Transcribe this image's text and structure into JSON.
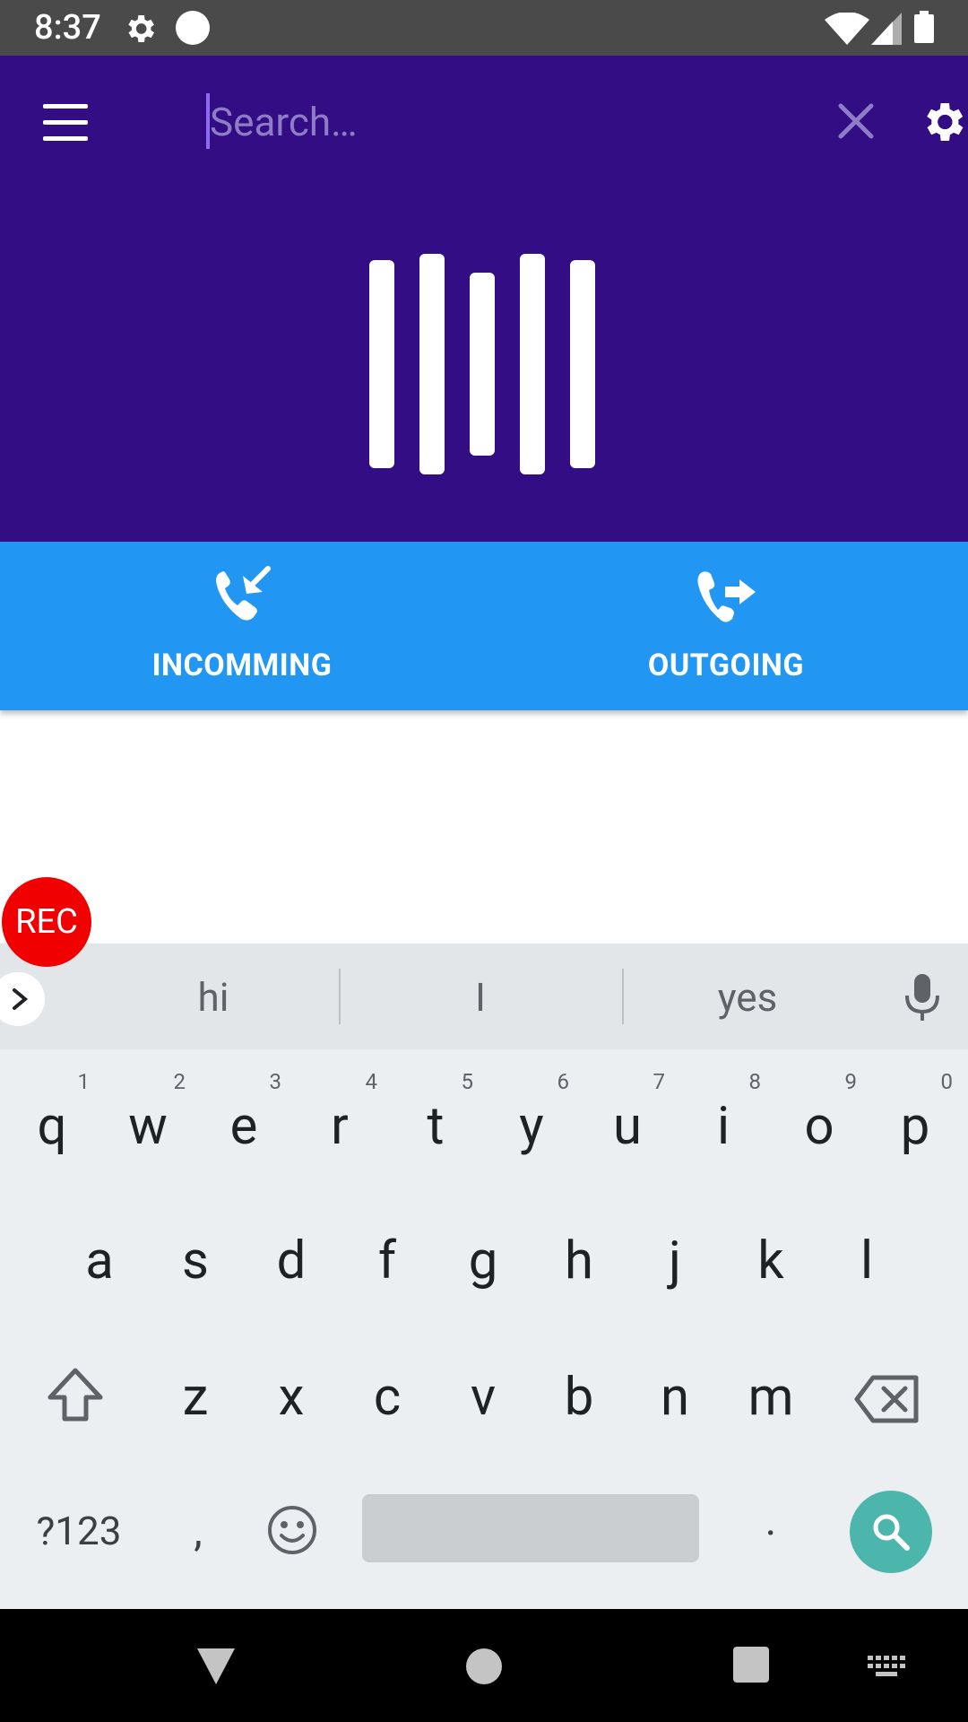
{
  "status_bar": {
    "time": "8:37",
    "icons": [
      "gear-icon",
      "dot-icon",
      "wifi-icon",
      "signal-icon",
      "battery-icon"
    ]
  },
  "header": {
    "search_placeholder": "Search…",
    "search_value": "",
    "background_color": "#320d84"
  },
  "tabs": [
    {
      "label": "INCOMMING",
      "icon": "incoming-call-icon"
    },
    {
      "label": "OUTGOING",
      "icon": "outgoing-call-icon"
    }
  ],
  "tabs_color": "#2196f3",
  "rec_button": {
    "label": "REC",
    "color": "#f00000"
  },
  "keyboard": {
    "suggestions": [
      "hi",
      "I",
      "yes"
    ],
    "row1": [
      {
        "key": "q",
        "hint": "1"
      },
      {
        "key": "w",
        "hint": "2"
      },
      {
        "key": "e",
        "hint": "3"
      },
      {
        "key": "r",
        "hint": "4"
      },
      {
        "key": "t",
        "hint": "5"
      },
      {
        "key": "y",
        "hint": "6"
      },
      {
        "key": "u",
        "hint": "7"
      },
      {
        "key": "i",
        "hint": "8"
      },
      {
        "key": "o",
        "hint": "9"
      },
      {
        "key": "p",
        "hint": "0"
      }
    ],
    "row2": [
      "a",
      "s",
      "d",
      "f",
      "g",
      "h",
      "j",
      "k",
      "l"
    ],
    "row3": [
      "z",
      "x",
      "c",
      "v",
      "b",
      "n",
      "m"
    ],
    "symbols_label": "?123",
    "comma_label": ",",
    "period_label": ".",
    "action_color": "#4db6ac"
  }
}
